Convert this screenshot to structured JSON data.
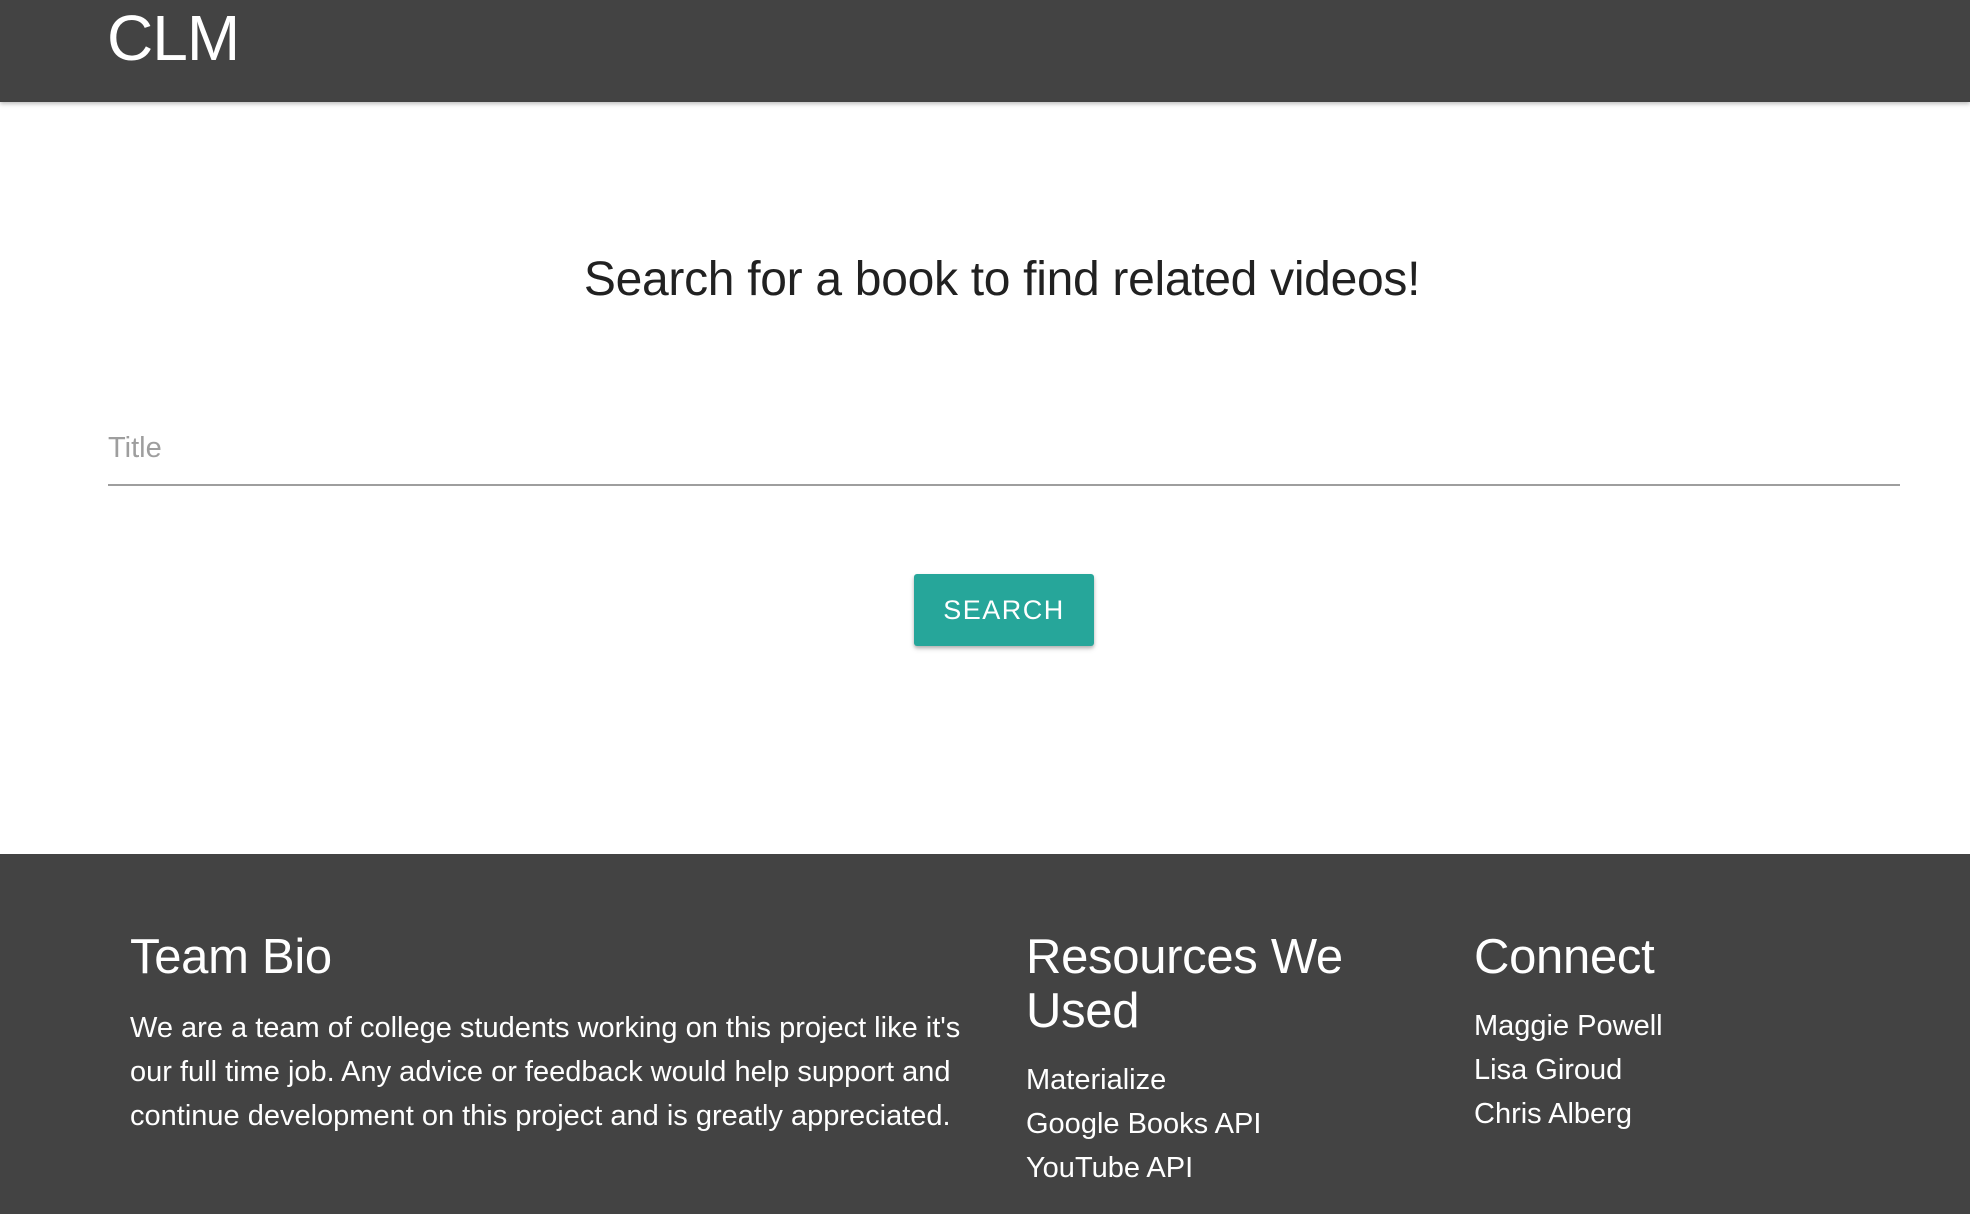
{
  "navbar": {
    "brand": "CLM"
  },
  "main": {
    "headline": "Search for a book to find related videos!",
    "title_input": {
      "placeholder": "Title",
      "value": ""
    },
    "search_button": "SEARCH"
  },
  "footer": {
    "bio": {
      "heading": "Team Bio",
      "text": "We are a team of college students working on this project like it's our full time job. Any advice or feedback would help support and continue development on this project and is greatly appreciated."
    },
    "resources": {
      "heading": "Resources We Used",
      "items": [
        "Materialize",
        "Google Books API",
        "YouTube API"
      ]
    },
    "connect": {
      "heading": "Connect",
      "items": [
        "Maggie Powell",
        "Lisa Giroud",
        "Chris Alberg"
      ]
    }
  },
  "colors": {
    "nav_bg": "#434343",
    "footer_bg": "#434343",
    "accent": "#26a69a",
    "input_underline": "#9e9e9e"
  }
}
